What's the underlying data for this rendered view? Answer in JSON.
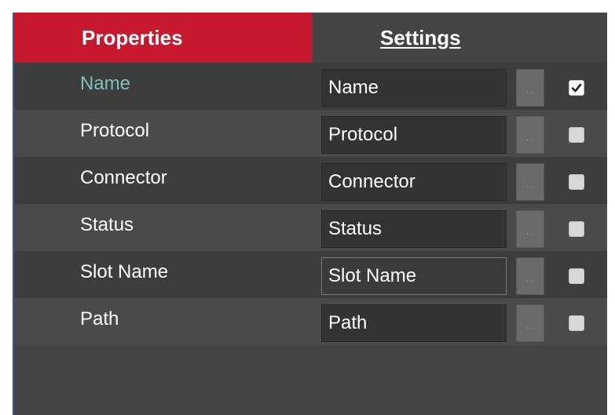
{
  "tabs": {
    "properties": "Properties",
    "settings": "Settings"
  },
  "rows": [
    {
      "label": "Name",
      "value": "Name",
      "browse": "...",
      "checked": true
    },
    {
      "label": "Protocol",
      "value": "Protocol",
      "browse": "...",
      "checked": false
    },
    {
      "label": "Connector",
      "value": "Connector",
      "browse": "...",
      "checked": false
    },
    {
      "label": "Status",
      "value": "Status",
      "browse": "...",
      "checked": false
    },
    {
      "label": "Slot Name",
      "value": "Slot Name",
      "browse": "...",
      "checked": false
    },
    {
      "label": "Path",
      "value": "Path",
      "browse": "...",
      "checked": false
    }
  ],
  "colors": {
    "accent": "#c6192f",
    "panel": "#444444",
    "active_label": "#7fbfb8"
  }
}
